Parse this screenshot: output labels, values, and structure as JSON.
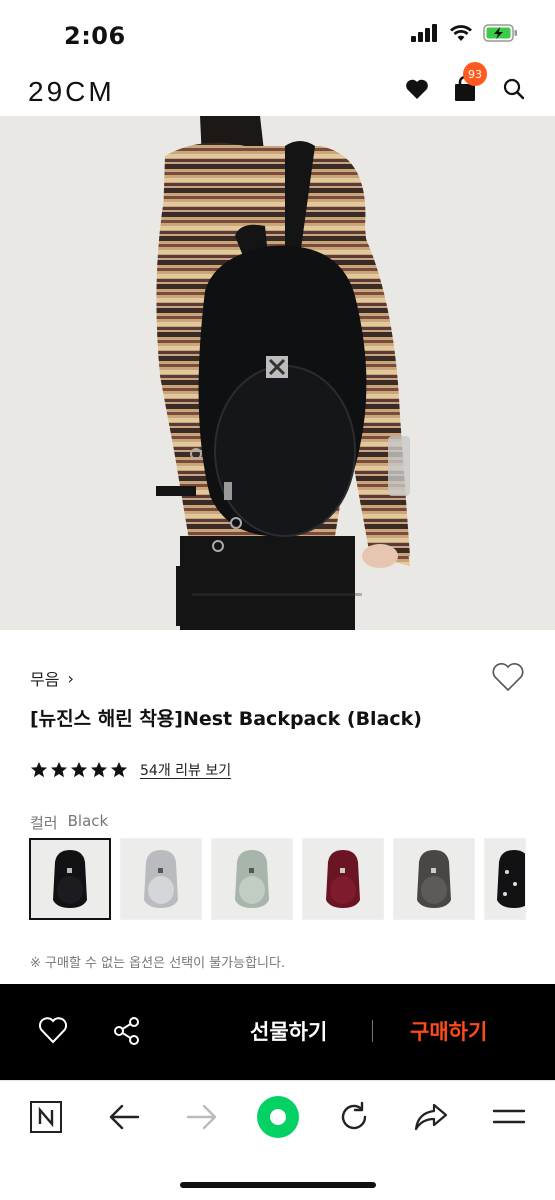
{
  "status_bar": {
    "time": "2:06"
  },
  "header": {
    "logo": "29CM",
    "cart_count": "93"
  },
  "product": {
    "brand": "무음",
    "brand_chevron": "›",
    "title": "[뉴진스 해린 착용]Nest Backpack (Black)",
    "rating_stars": 5,
    "review_link": "54개 리뷰 보기",
    "color_label": "컬러",
    "color_value": "Black",
    "color_options": [
      "black",
      "light-gray",
      "sage",
      "burgundy",
      "charcoal",
      "black-pattern"
    ],
    "notice": "※ 구매할 수 없는 옵션은 선택이 불가능합니다."
  },
  "action_bar": {
    "gift_label": "선물하기",
    "buy_label": "구매하기"
  },
  "colors": {
    "accent": "#ff4a1c",
    "badge": "#ff5a1f",
    "bar": "#000000"
  }
}
